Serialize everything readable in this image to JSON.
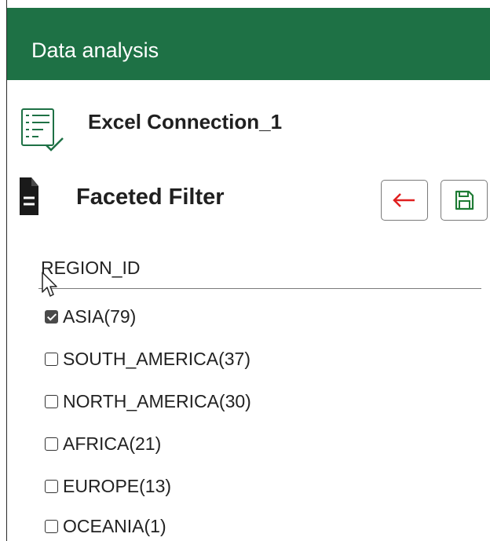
{
  "header": {
    "title": "Data analysis",
    "background_color": "#1e7145"
  },
  "connection": {
    "icon": "list-check-icon",
    "name": "Excel Connection_1"
  },
  "facet": {
    "icon": "document-icon",
    "title": "Faceted Filter",
    "back_icon": "arrow-left-icon",
    "save_icon": "floppy-save-icon"
  },
  "filter": {
    "field_label": "REGION_ID",
    "options": [
      {
        "label": "ASIA(79)",
        "checked": true
      },
      {
        "label": "SOUTH_AMERICA(37)",
        "checked": false
      },
      {
        "label": "NORTH_AMERICA(30)",
        "checked": false
      },
      {
        "label": "AFRICA(21)",
        "checked": false
      },
      {
        "label": "EUROPE(13)",
        "checked": false
      },
      {
        "label": "OCEANIA(1)",
        "checked": false
      }
    ]
  },
  "colors": {
    "accent_green": "#1e7145",
    "back_arrow_red": "#e02020",
    "save_icon_green": "#1e7b34"
  }
}
